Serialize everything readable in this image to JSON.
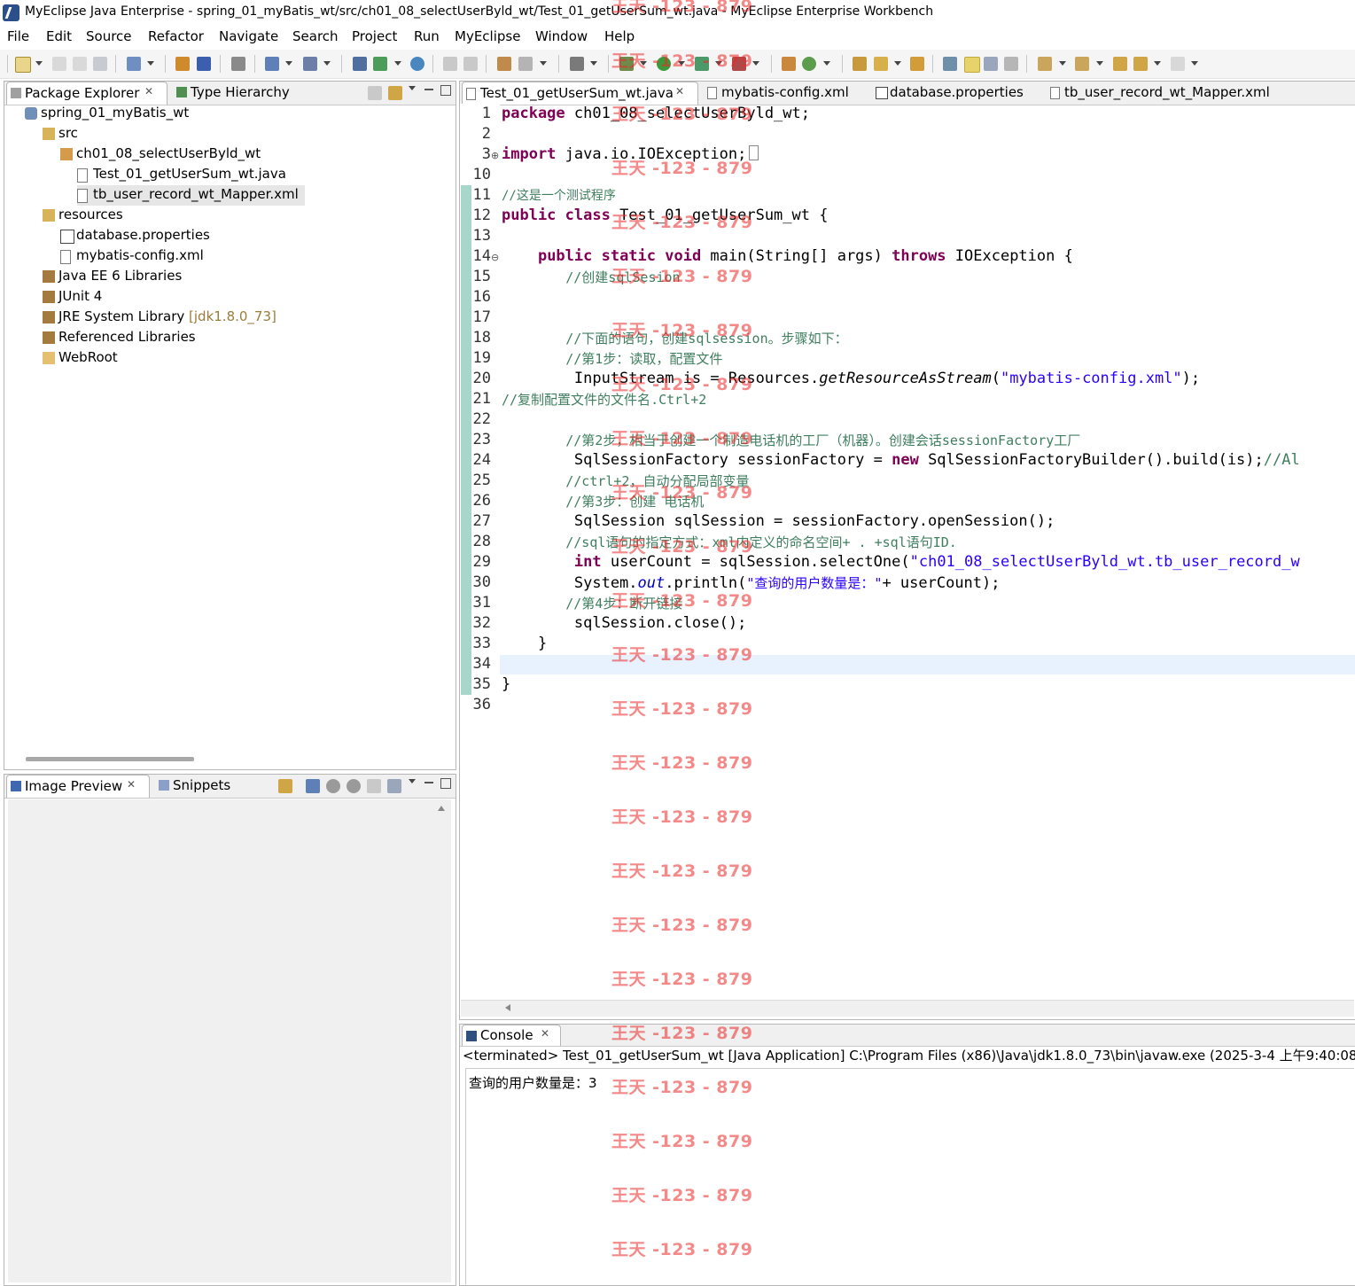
{
  "window": {
    "title": "MyEclipse Java Enterprise - spring_01_myBatis_wt/src/ch01_08_selectUserByld_wt/Test_01_getUserSum_wt.java - MyEclipse Enterprise Workbench"
  },
  "menu": [
    "File",
    "Edit",
    "Source",
    "Refactor",
    "Navigate",
    "Search",
    "Project",
    "Run",
    "MyEclipse",
    "Window",
    "Help"
  ],
  "left_panel": {
    "tabs": [
      "Package Explorer",
      "Type Hierarchy"
    ],
    "tree": [
      {
        "label": "spring_01_myBatis_wt",
        "icon": "project-icon",
        "level": 0
      },
      {
        "label": "src",
        "icon": "source-folder-icon",
        "level": 1
      },
      {
        "label": "ch01_08_selectUserByld_wt",
        "icon": "package-icon",
        "level": 2
      },
      {
        "label": "Test_01_getUserSum_wt.java",
        "icon": "java-file-icon",
        "level": 3
      },
      {
        "label": "tb_user_record_wt_Mapper.xml",
        "icon": "xml-file-icon",
        "level": 3,
        "selected": true
      },
      {
        "label": "resources",
        "icon": "source-folder-icon",
        "level": 1
      },
      {
        "label": "database.properties",
        "icon": "properties-file-icon",
        "level": 2
      },
      {
        "label": "mybatis-config.xml",
        "icon": "xml-file-icon",
        "level": 2
      },
      {
        "label": "Java EE 6 Libraries",
        "icon": "library-icon",
        "level": 1
      },
      {
        "label": "JUnit 4",
        "icon": "library-icon",
        "level": 1
      },
      {
        "label": "JRE System Library",
        "hint": "[jdk1.8.0_73]",
        "icon": "library-icon",
        "level": 1
      },
      {
        "label": "Referenced Libraries",
        "icon": "library-icon",
        "level": 1
      },
      {
        "label": "WebRoot",
        "icon": "folder-icon",
        "level": 1
      }
    ]
  },
  "bottom_left_panel": {
    "tabs": [
      "Image Preview",
      "Snippets"
    ]
  },
  "editor": {
    "tabs": [
      "Test_01_getUserSum_wt.java",
      "mybatis-config.xml",
      "database.properties",
      "tb_user_record_wt_Mapper.xml"
    ],
    "line_numbers": [
      "1",
      "2",
      "3",
      "10",
      "11",
      "12",
      "13",
      "14",
      "15",
      "16",
      "17",
      "18",
      "19",
      "20",
      "21",
      "22",
      "23",
      "24",
      "25",
      "26",
      "27",
      "28",
      "29",
      "30",
      "31",
      "32",
      "33",
      "34",
      "35",
      "36"
    ],
    "lines": {
      "l1_kw": "package",
      "l1_rest": " ch01_08_selectUserByld_wt;",
      "l3_kw": "import",
      "l3_rest": " java.io.IOException;",
      "l11": "//这是一个测试程序",
      "l12_kw": "public class",
      "l12_rest": " Test_01_getUserSum_wt {",
      "l14_pre": "    ",
      "l14_kw": "public static void",
      "l14_mid": " main(String[] args) ",
      "l14_kw2": "throws",
      "l14_rest": " IOException {",
      "l15": "        //创建sqlSesion",
      "l18": "        //下面的语句，创建sqlsession。步骤如下：",
      "l19": "        //第1步：读取，配置文件",
      "l20_pre": "        InputStream is = Resources.",
      "l20_it": "getResourceAsStream",
      "l20_open": "(",
      "l20_str": "\"mybatis-config.xml\"",
      "l20_close": ");",
      "l21": "//复制配置文件的文件名.Ctrl+2",
      "l23": "        //第2步，相当于创建一个制造电话机的工厂（机器）。创建会话sessionFactory工厂",
      "l24_pre": "        SqlSessionFactory sessionFactory = ",
      "l24_kw": "new",
      "l24_rest": " SqlSessionFactoryBuilder().build(is);",
      "l24_cm": "//Al",
      "l25": "        //ctrl+2，自动分配局部变量",
      "l26": "        //第3步：创建 电话机",
      "l27": "        SqlSession sqlSession = sessionFactory.openSession();",
      "l28": "        //sql语句的指定方式：xml内定义的命名空间+ . +sql语句ID.",
      "l29_pre": "        ",
      "l29_kw": "int",
      "l29_mid": " userCount = sqlSession.selectOne(",
      "l29_str": "\"ch01_08_selectUserByld_wt.tb_user_record_w",
      "l30_pre": "        System.",
      "l30_fld": "out",
      "l30_mid": ".println(",
      "l30_str": "\"查询的用户数量是：\"",
      "l30_rest": "+ userCount);",
      "l31": "        //第4步：断开链接",
      "l32": "        sqlSession.close();",
      "l33": "    }",
      "l35": "}"
    }
  },
  "console": {
    "tab": "Console",
    "status": "<terminated> Test_01_getUserSum_wt [Java Application] C:\\Program Files (x86)\\Java\\jdk1.8.0_73\\bin\\javaw.exe (2025-3-4 上午9:40:08)",
    "output": "查询的用户数量是：3"
  },
  "watermark": "王天 -123 - 879"
}
